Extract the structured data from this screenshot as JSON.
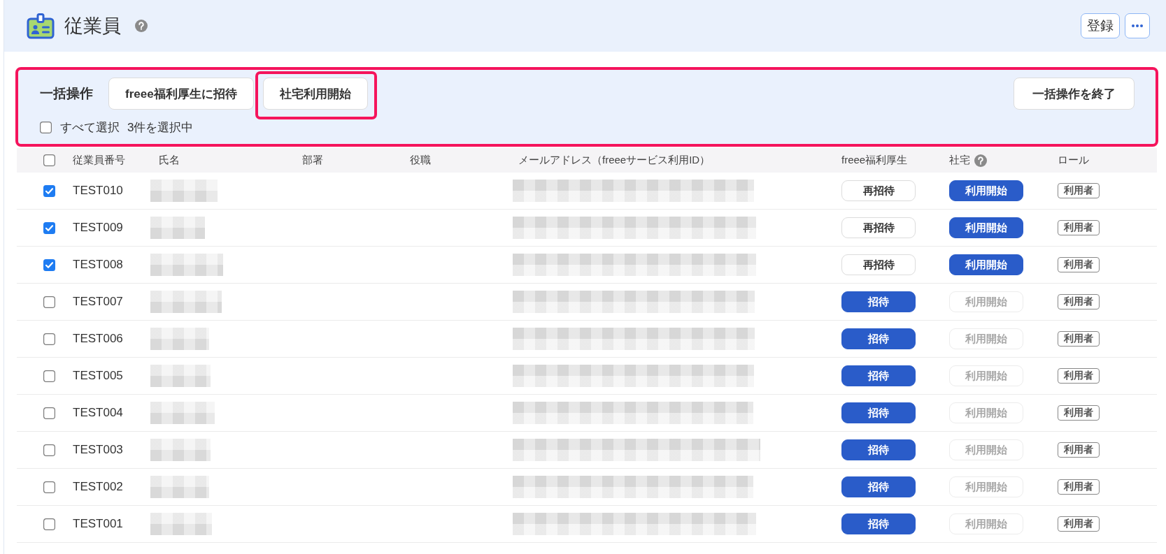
{
  "page": {
    "title": "従業員",
    "help": true,
    "actions": [
      {
        "kind": "text",
        "label": "登録"
      },
      {
        "kind": "more"
      }
    ]
  },
  "bulk_actions": {
    "label": "一括操作",
    "buttons": [
      {
        "label": "freee福利厚生に招待",
        "highlighted": false
      },
      {
        "label": "社宅利用開始",
        "highlighted": true
      }
    ],
    "end_button": "一括操作を終了",
    "select_all": {
      "label": "すべて選択",
      "checked": false
    },
    "selection_count": "3件を選択中"
  },
  "table": {
    "header_checkbox": {
      "checked": false
    },
    "columns": [
      {
        "label": "従業員番号",
        "help": false
      },
      {
        "label": "氏名",
        "help": false
      },
      {
        "label": "部署",
        "help": false
      },
      {
        "label": "役職",
        "help": false
      },
      {
        "label": "メールアドレス（freeeサービス利用ID）",
        "help": false
      },
      {
        "label": "freee福利厚生",
        "help": false
      },
      {
        "label": "社宅",
        "help": true
      },
      {
        "label": "ロール",
        "help": false
      }
    ],
    "rows": [
      {
        "selected": true,
        "employee_number": "TEST010",
        "welfare": {
          "kind": "outline",
          "label": "再招待"
        },
        "housing": {
          "label": "利用開始",
          "disabled": false
        },
        "role": "利用者"
      },
      {
        "selected": true,
        "employee_number": "TEST009",
        "welfare": {
          "kind": "outline",
          "label": "再招待"
        },
        "housing": {
          "label": "利用開始",
          "disabled": false
        },
        "role": "利用者"
      },
      {
        "selected": true,
        "employee_number": "TEST008",
        "welfare": {
          "kind": "outline",
          "label": "再招待"
        },
        "housing": {
          "label": "利用開始",
          "disabled": false
        },
        "role": "利用者"
      },
      {
        "selected": false,
        "employee_number": "TEST007",
        "welfare": {
          "kind": "primary",
          "label": "招待"
        },
        "housing": {
          "label": "利用開始",
          "disabled": true
        },
        "role": "利用者"
      },
      {
        "selected": false,
        "employee_number": "TEST006",
        "welfare": {
          "kind": "primary",
          "label": "招待"
        },
        "housing": {
          "label": "利用開始",
          "disabled": true
        },
        "role": "利用者"
      },
      {
        "selected": false,
        "employee_number": "TEST005",
        "welfare": {
          "kind": "primary",
          "label": "招待"
        },
        "housing": {
          "label": "利用開始",
          "disabled": true
        },
        "role": "利用者"
      },
      {
        "selected": false,
        "employee_number": "TEST004",
        "welfare": {
          "kind": "primary",
          "label": "招待"
        },
        "housing": {
          "label": "利用開始",
          "disabled": true
        },
        "role": "利用者"
      },
      {
        "selected": false,
        "employee_number": "TEST003",
        "welfare": {
          "kind": "primary",
          "label": "招待"
        },
        "housing": {
          "label": "利用開始",
          "disabled": true
        },
        "role": "利用者"
      },
      {
        "selected": false,
        "employee_number": "TEST002",
        "welfare": {
          "kind": "primary",
          "label": "招待"
        },
        "housing": {
          "label": "利用開始",
          "disabled": true
        },
        "role": "利用者"
      },
      {
        "selected": false,
        "employee_number": "TEST001",
        "welfare": {
          "kind": "primary",
          "label": "招待"
        },
        "housing": {
          "label": "利用開始",
          "disabled": true
        },
        "role": "利用者"
      }
    ]
  }
}
